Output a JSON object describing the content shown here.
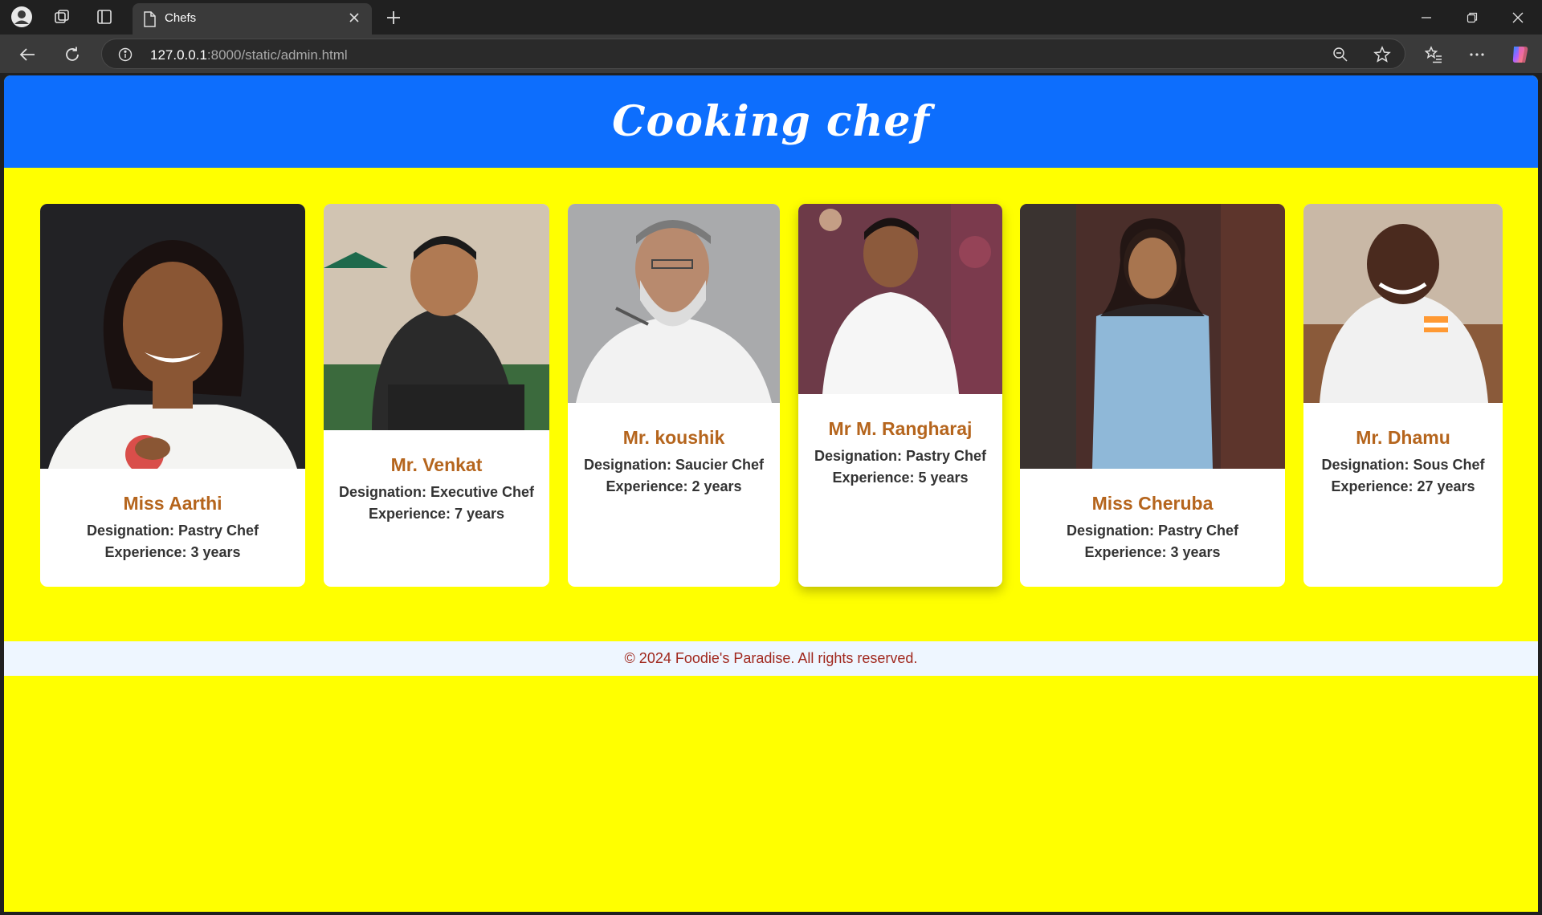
{
  "browser": {
    "tab_title": "Chefs",
    "url_host": "127.0.0.1",
    "url_rest": ":8000/static/admin.html",
    "icons": [
      "profile-icon",
      "workspaces-icon",
      "tab-actions-icon",
      "page-icon",
      "close-tab-icon",
      "new-tab-icon",
      "minimize-icon",
      "restore-icon",
      "close-window-icon",
      "back-icon",
      "refresh-icon",
      "info-icon",
      "zoom-icon",
      "favorite-star-icon",
      "favorites-icon",
      "more-icon",
      "copilot-icon"
    ]
  },
  "header": {
    "title": "Cooking chef"
  },
  "chefs": [
    {
      "name": "Miss Aarthi",
      "designation": "Designation: Pastry Chef",
      "experience": "Experience: 3 years"
    },
    {
      "name": "Mr. Venkat",
      "designation": "Designation: Executive Chef",
      "experience": "Experience: 7 years"
    },
    {
      "name": "Mr. koushik",
      "designation": "Designation: Saucier Chef",
      "experience": "Experience: 2 years"
    },
    {
      "name": "Mr M. Rangharaj",
      "designation": "Designation: Pastry Chef",
      "experience": "Experience: 5 years"
    },
    {
      "name": "Miss Cheruba",
      "designation": "Designation: Pastry Chef",
      "experience": "Experience: 3 years"
    },
    {
      "name": "Mr. Dhamu",
      "designation": "Designation: Sous Chef",
      "experience": "Experience: 27 years"
    }
  ],
  "footer": {
    "text": "© 2024 Foodie's Paradise. All rights reserved."
  },
  "colors": {
    "header_bg": "#0d6efd",
    "page_bg": "#ffff00",
    "name_color": "#b5651d",
    "footer_text": "#a0281e"
  }
}
